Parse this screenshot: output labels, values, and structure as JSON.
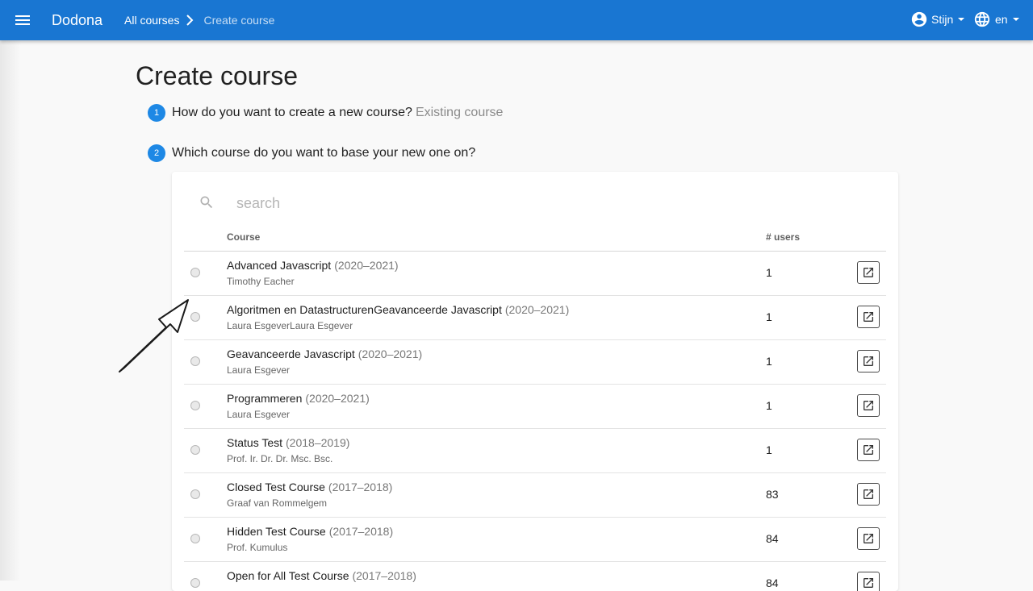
{
  "app": {
    "brand": "Dodona",
    "menu_icon": "menu-icon",
    "breadcrumb": {
      "link": "All courses",
      "current": "Create course"
    },
    "user": {
      "name": "Stijn",
      "icon": "account-circle-icon"
    },
    "language": {
      "code": "en",
      "icon": "globe-icon"
    },
    "accent_color": "#1976d2"
  },
  "page": {
    "title": "Create course",
    "steps": [
      {
        "number": "1",
        "question": "How do you want to create a new course?",
        "answer": "Existing course"
      },
      {
        "number": "2",
        "question": "Which course do you want to base your new one on?"
      }
    ]
  },
  "table": {
    "search_placeholder": "search",
    "headers": {
      "course": "Course",
      "users": "# users"
    },
    "rows": [
      {
        "name": "Advanced Javascript",
        "year": "(2020–2021)",
        "teacher": "Timothy Eacher",
        "users": "1"
      },
      {
        "name": "Algoritmen en DatastructurenGeavanceerde Javascript",
        "year": "(2020–2021)",
        "teacher": "Laura EsgeverLaura Esgever",
        "users": "1"
      },
      {
        "name": "Geavanceerde Javascript",
        "year": "(2020–2021)",
        "teacher": "Laura Esgever",
        "users": "1"
      },
      {
        "name": "Programmeren",
        "year": "(2020–2021)",
        "teacher": "Laura Esgever",
        "users": "1"
      },
      {
        "name": "Status Test",
        "year": "(2018–2019)",
        "teacher": "Prof. Ir. Dr. Dr. Msc. Bsc.",
        "users": "1"
      },
      {
        "name": "Closed Test Course",
        "year": "(2017–2018)",
        "teacher": "Graaf van Rommelgem",
        "users": "83"
      },
      {
        "name": "Hidden Test Course",
        "year": "(2017–2018)",
        "teacher": "Prof. Kumulus",
        "users": "84"
      },
      {
        "name": "Open for All Test Course",
        "year": "(2017–2018)",
        "teacher": "",
        "users": "84"
      }
    ]
  }
}
